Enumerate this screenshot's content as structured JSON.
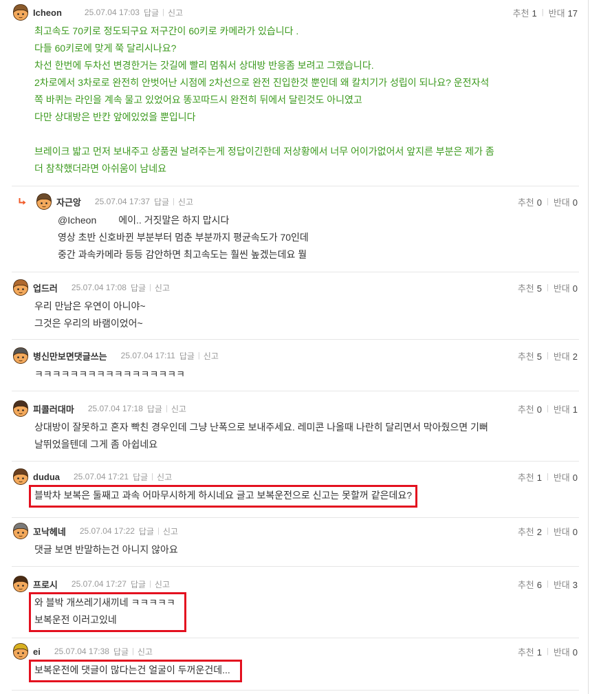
{
  "labels": {
    "reply": "답글",
    "report": "신고",
    "separator": "|",
    "up": "추천",
    "down": "반대"
  },
  "colors": {
    "body_text": "#333333",
    "green_text": "#3c9a1e",
    "meta_text": "#999999",
    "divider": "#e6e6e6",
    "reply_arrow": "#f05a28",
    "highlight_box": "#e3101f"
  },
  "comments": [
    {
      "username": "Icheon",
      "date": "25.07.04 17:03",
      "up": "1",
      "down": "17",
      "lines": [
        "최고속도 70키로 정도되구요 저구간이 60키로 카메라가 있습니다 .",
        "다들 60키로에 맞게 쭉 달리시나요?",
        "차선 한번에 두차선 변경한거는 갓길에 빨리 멈춰서 상대방 반응좀 보려고 그랬습니다.",
        "2차로에서 3차로로 완전히 안벗어난 시점에 2차선으로 완전 진입한것 뿐인데 왜 칼치기가 성립이 되나요? 운전자석",
        "쪽 바퀴는 라인을 계속 물고 있었어요 똥꼬따드시 완전히 뒤에서 달린것도 아니였고",
        "다만 상대방은 반칸 앞에있었을 뿐입니다",
        "브레이크 밟고 먼저 보내주고 상품권 날려주는게 정답이긴한데 저상황에서 너무 어이가없어서 앞지른 부분은 제가 좀",
        "더 참착했더라면 아쉬움이 남네요"
      ]
    },
    {
      "username": "자근앙",
      "date": "25.07.04 17:37",
      "up": "0",
      "down": "0",
      "mention": "@Icheon",
      "lines": [
        "에이.. 거짓말은 하지 맙시다",
        "영상 초반 신호바뀐 부분부터 멈춘 부분까지 평균속도가 70인데",
        "중간 과속카메라 등등 감안하면 최고속도는 훨씬 높겠는데요 뭘"
      ]
    },
    {
      "username": "업드러",
      "date": "25.07.04 17:08",
      "up": "5",
      "down": "0",
      "lines": [
        "우리 만남은 우연이 아니야~",
        "그것은 우리의 바램이었어~"
      ]
    },
    {
      "username": "병신만보면댓글쓰는",
      "date": "25.07.04 17:11",
      "up": "5",
      "down": "2",
      "lines": [
        "ㅋㅋㅋㅋㅋㅋㅋㅋㅋㅋㅋㅋㅋㅋㅋㅋㅋ"
      ]
    },
    {
      "username": "피콜러대마",
      "date": "25.07.04 17:18",
      "up": "0",
      "down": "1",
      "lines": [
        "상대방이 잘못하고 혼자 빡친 경우인데 그냥 난폭으로 보내주세요. 레미콘 나올때 나란히 달리면서 막아줬으면 기뻐",
        "날뛰었을텐데 그게 좀 아쉽네요"
      ]
    },
    {
      "username": "dudua",
      "date": "25.07.04 17:21",
      "up": "1",
      "down": "0",
      "lines": [
        "블박차 보복은 둘째고 과속 어마무시하게 하시네요 글고 보복운전으로 신고는 못할꺼 같은데요?"
      ]
    },
    {
      "username": "꼬낙헤네",
      "date": "25.07.04 17:22",
      "up": "2",
      "down": "0",
      "lines": [
        "댓글 보면 반말하는건 아니지 않아요"
      ]
    },
    {
      "username": "프로시",
      "date": "25.07.04 17:27",
      "up": "6",
      "down": "3",
      "lines": [
        "와 블박 개쓰레기새끼네 ㅋㅋㅋㅋㅋ",
        "보복운전 이러고있네"
      ]
    },
    {
      "username": "ei",
      "date": "25.07.04 17:38",
      "up": "1",
      "down": "0",
      "lines": [
        "보복운전에 댓글이 많다는건 얼굴이 두꺼운건데..."
      ]
    }
  ]
}
